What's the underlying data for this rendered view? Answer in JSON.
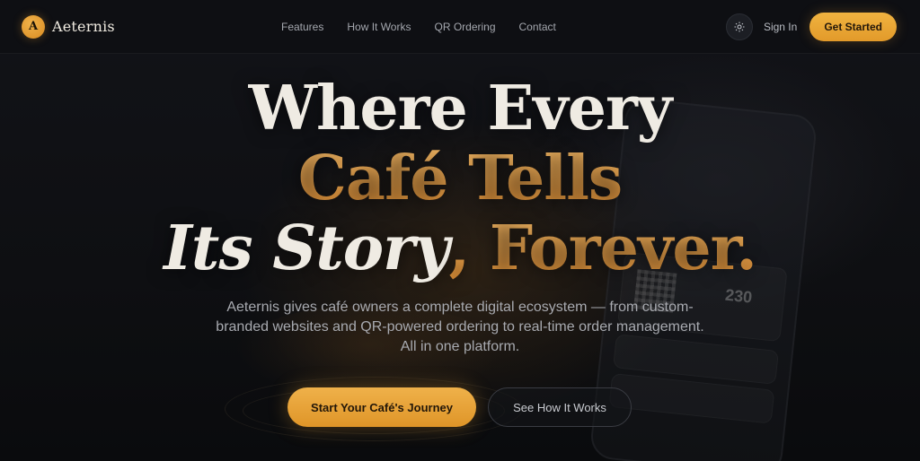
{
  "nav": {
    "brand_initial": "A",
    "brand_name": "Aeternis",
    "links": [
      "Features",
      "How It Works",
      "QR Ordering",
      "Contact"
    ],
    "theme_icon": "sun-icon",
    "sign_in": "Sign In",
    "get_started": "Get Started"
  },
  "hero": {
    "title_line1": "Where Every",
    "title_line2": "Café Tells",
    "title_line3_a": "Its Story",
    "title_line3_b": ", Forever.",
    "subtitle": "Aeternis gives café owners a complete digital ecosystem — from custom-branded websites and QR-powered ordering to real-time order management. All in one platform.",
    "cta_primary": "Start Your Café's Journey",
    "cta_secondary": "See How It Works"
  },
  "background": {
    "phone_number": "230"
  },
  "colors": {
    "accent": "#e9a34a",
    "background": "#0e0f12",
    "title": "#efebe3"
  }
}
